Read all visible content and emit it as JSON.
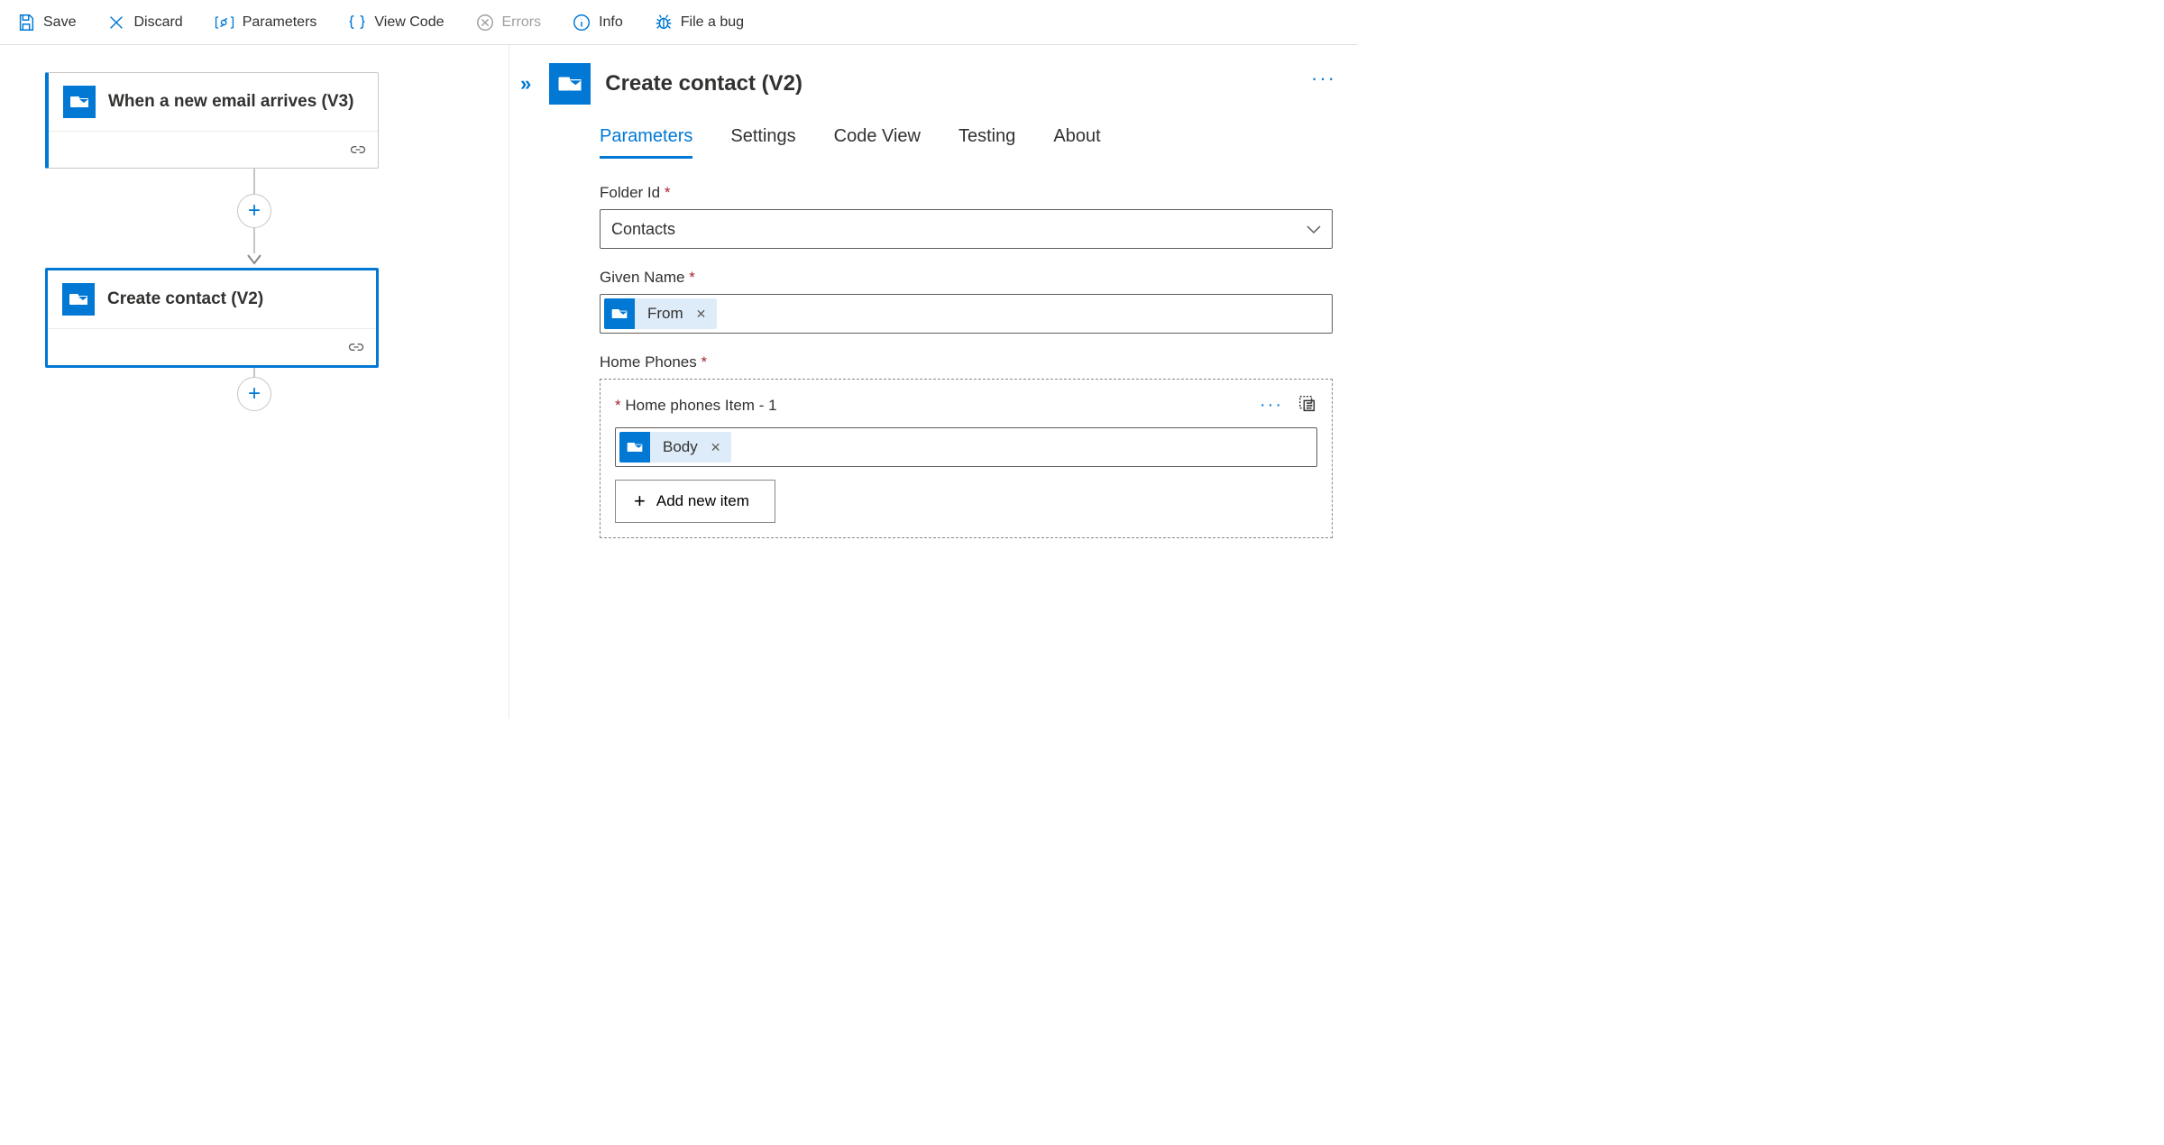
{
  "toolbar": {
    "save": "Save",
    "discard": "Discard",
    "parameters": "Parameters",
    "viewCode": "View Code",
    "errors": "Errors",
    "info": "Info",
    "fileBug": "File a bug"
  },
  "canvas": {
    "trigger": {
      "title": "When a new email arrives (V3)"
    },
    "action": {
      "title": "Create contact (V2)"
    }
  },
  "panel": {
    "title": "Create contact (V2)",
    "tabs": [
      "Parameters",
      "Settings",
      "Code View",
      "Testing",
      "About"
    ],
    "activeTab": 0,
    "fields": {
      "folderId": {
        "label": "Folder Id",
        "value": "Contacts"
      },
      "givenName": {
        "label": "Given Name",
        "token": "From"
      },
      "homePhones": {
        "label": "Home Phones",
        "itemLabel": "Home phones Item - 1",
        "token": "Body",
        "addLabel": "Add new item"
      }
    }
  }
}
